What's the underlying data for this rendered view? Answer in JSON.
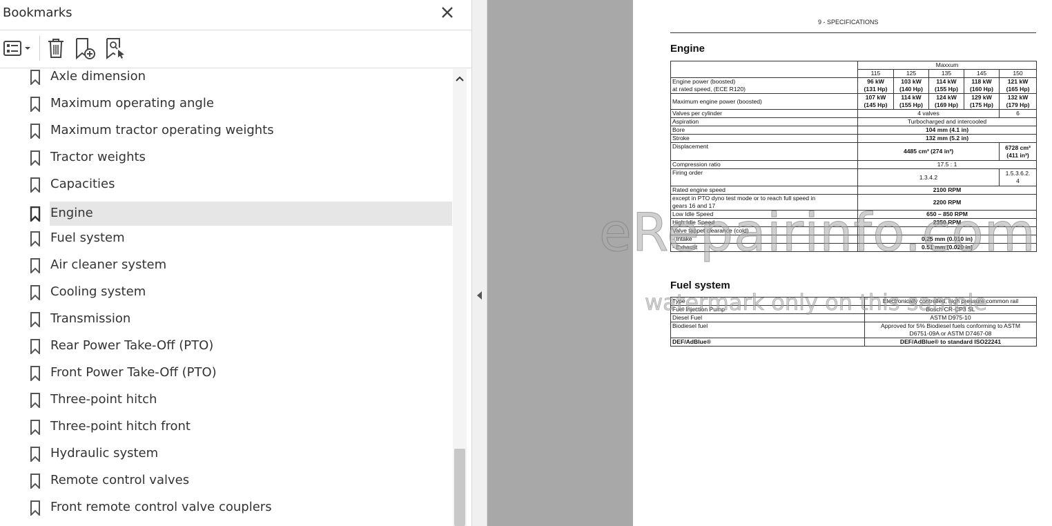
{
  "bookmarks_panel": {
    "title": "Bookmarks",
    "items": [
      {
        "label": "Axle dimension"
      },
      {
        "label": "Maximum operating angle"
      },
      {
        "label": "Maximum tractor operating weights"
      },
      {
        "label": "Tractor weights"
      },
      {
        "label": "Capacities"
      },
      {
        "label": "Engine",
        "selected": true
      },
      {
        "label": "Fuel system"
      },
      {
        "label": "Air cleaner system"
      },
      {
        "label": "Cooling system"
      },
      {
        "label": "Transmission"
      },
      {
        "label": "Rear Power Take-Off (PTO)"
      },
      {
        "label": "Front Power Take-Off (PTO)"
      },
      {
        "label": "Three-point hitch"
      },
      {
        "label": "Three-point hitch front"
      },
      {
        "label": "Hydraulic system"
      },
      {
        "label": "Remote control valves"
      },
      {
        "label": "Front remote control valve couplers"
      }
    ]
  },
  "document": {
    "page_header": "9 - SPECIFICATIONS",
    "engine": {
      "title": "Engine",
      "model_group": "Maxxum",
      "models": [
        "115",
        "125",
        "135",
        "145",
        "150"
      ],
      "power_boosted": {
        "label_line1": "Engine power (boosted)",
        "label_line2": "at rated speed, (ECE R120)",
        "values": [
          {
            "kw": "96 kW",
            "hp": "(131 Hp)"
          },
          {
            "kw": "103 kW",
            "hp": "(140 Hp)"
          },
          {
            "kw": "114 kW",
            "hp": "(155 Hp)"
          },
          {
            "kw": "118 kW",
            "hp": "(160 Hp)"
          },
          {
            "kw": "121 kW",
            "hp": "(165 Hp)"
          }
        ]
      },
      "max_power": {
        "label": "Maximum engine power (boosted)",
        "values": [
          {
            "kw": "107 kW",
            "hp": "(145 Hp)"
          },
          {
            "kw": "114 kW",
            "hp": "(155 Hp)"
          },
          {
            "kw": "124 kW",
            "hp": "(169 Hp)"
          },
          {
            "kw": "129 kW",
            "hp": "(175 Hp)"
          },
          {
            "kw": "132 kW",
            "hp": "(179 Hp)"
          }
        ]
      },
      "valves": {
        "label": "Valves per cylinder",
        "value_main": "4 valves",
        "value_150": "6"
      },
      "aspiration": {
        "label": "Aspiration",
        "value": "Turbocharged and intercooled"
      },
      "bore": {
        "label": "Bore",
        "value": "104 mm (4.1 in)"
      },
      "stroke": {
        "label": "Stroke",
        "value": "132 mm (5.2 in)"
      },
      "displacement": {
        "label": "Displacement",
        "value_main": "4485 cm³ (274 in³)",
        "value_150_line1": "6728 cm³",
        "value_150_line2": "(411 in³)"
      },
      "compression": {
        "label": "Compression ratio",
        "value": "17.5 : 1"
      },
      "firing": {
        "label": "Firing order",
        "value_main": "1.3.4.2",
        "value_150_line1": "1.5.3.6.2.",
        "value_150_line2": "4"
      },
      "rated_speed": {
        "label": "Rated engine speed",
        "value": "2100 RPM"
      },
      "pto_speed": {
        "label_line1": "except in PTO dyno test mode or to reach full speed in",
        "label_line2": "gears 16 and 17",
        "value": "2200 RPM"
      },
      "low_idle": {
        "label": "Low Idle Speed",
        "value": "650 – 850 RPM"
      },
      "high_idle": {
        "label": "High Idle Speed",
        "value": "2350 RPM"
      },
      "tappet": {
        "label": "Valve tappet clearance (cold)"
      },
      "intake": {
        "label": "- Intake",
        "value": "0.25 mm (0.010 in)"
      },
      "exhaust": {
        "label": "- Exhaust",
        "value": "0.51 mm (0.020 in)"
      }
    },
    "fuel": {
      "title": "Fuel system",
      "rows": [
        {
          "label": "Type",
          "value_line1": "Electronically controlled, high pressure common rail",
          "value_line2": "",
          "bold": false
        },
        {
          "label": "Fuel Injection Pump",
          "value_line1": "Bosch CR-CP3 SL",
          "value_line2": "",
          "bold": false
        },
        {
          "label": "Diesel Fuel",
          "value_line1": "ASTM D975-10",
          "value_line2": "",
          "bold": false
        },
        {
          "label": "Biodiesel fuel",
          "value_line1": "Approved for 5% Biodiesel fuels conforming to ASTM",
          "value_line2": "D6751-09A or ASTM D7467-08",
          "bold": false
        },
        {
          "label": "DEF/AdBlue®",
          "value_line1": "DEF/AdBlue® to standard ISO22241",
          "value_line2": "",
          "bold": true
        }
      ]
    },
    "watermark_main": "eRepairinfo.com",
    "watermark_sub": "watermark only on this sample"
  },
  "icons": {
    "options": "list-options-icon",
    "delete": "trash-icon",
    "new_bookmark": "bookmark-add-icon",
    "find_bookmark": "bookmark-search-icon",
    "close": "close-icon",
    "bookmark": "bookmark-icon"
  }
}
